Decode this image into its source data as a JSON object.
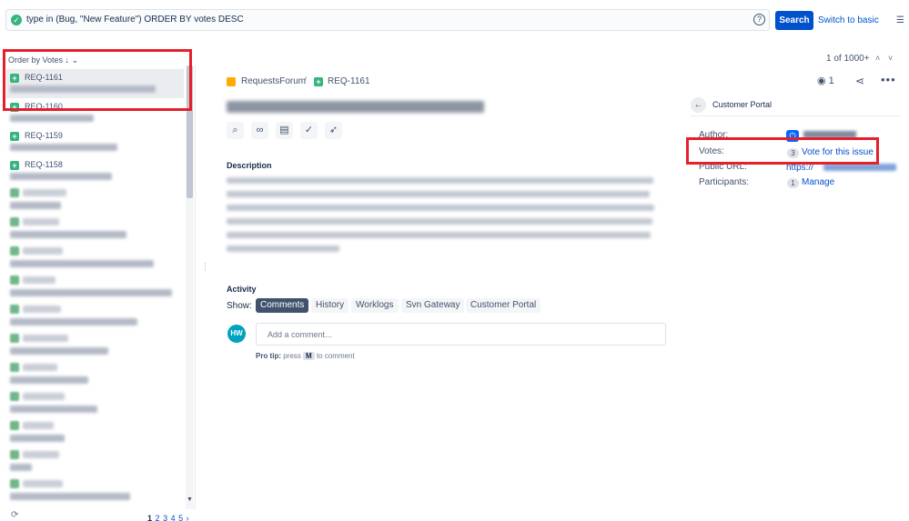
{
  "search": {
    "query": "type in (Bug, \"New Feature\") ORDER BY votes DESC",
    "button_label": "Search",
    "switch_label": "Switch to basic"
  },
  "issue_list": {
    "order_label": "Order by Votes",
    "items": [
      {
        "key": "REQ-1161",
        "selected": true
      },
      {
        "key": "REQ-1160",
        "selected": false
      },
      {
        "key": "REQ-1159",
        "selected": false
      },
      {
        "key": "REQ-1158",
        "selected": false
      }
    ],
    "pager": [
      "1",
      "2",
      "3",
      "4",
      "5",
      "›"
    ]
  },
  "detail": {
    "position": "1 of 1000+",
    "breadcrumb": {
      "project": "RequestsForum",
      "separator": "/",
      "key": "REQ-1161"
    },
    "watch_count": "1",
    "description_label": "Description",
    "activity": {
      "label": "Activity",
      "show_label": "Show:",
      "tabs": [
        {
          "label": "Comments",
          "active": true
        },
        {
          "label": "History",
          "active": false
        },
        {
          "label": "Worklogs",
          "active": false
        },
        {
          "label": "Svn Gateway",
          "active": false
        },
        {
          "label": "Customer Portal",
          "active": false
        }
      ]
    },
    "comment": {
      "avatar_initials": "HW",
      "placeholder": "Add a comment...",
      "pro_tip_label": "Pro tip:",
      "pro_tip_text": "press",
      "pro_tip_key": "M",
      "pro_tip_suffix": "to comment"
    }
  },
  "side_panel": {
    "title": "Customer Portal",
    "fields": {
      "author_label": "Author:",
      "votes_label": "Votes:",
      "votes_count": "3",
      "vote_link": "Vote for this issue",
      "public_url_label": "Public URL:",
      "public_url_value": "https://",
      "participants_label": "Participants:",
      "participants_count": "1",
      "participants_link": "Manage"
    }
  },
  "colors": {
    "accent": "#0052cc",
    "highlight": "#e5202b",
    "story": "#36b37e"
  }
}
